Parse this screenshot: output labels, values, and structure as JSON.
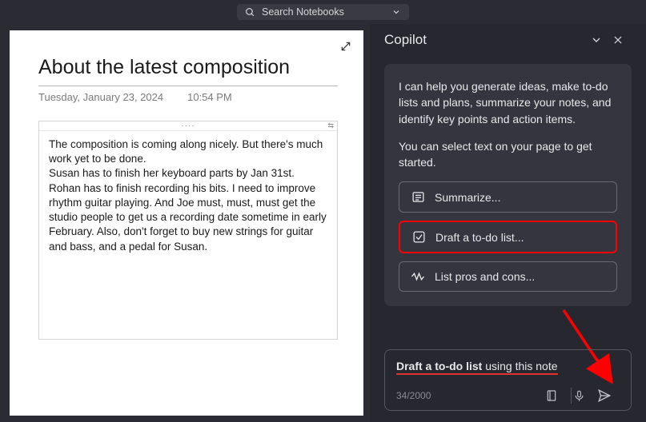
{
  "topbar": {
    "search_placeholder": "Search Notebooks"
  },
  "note": {
    "title": "About the latest composition",
    "date": "Tuesday, January 23, 2024",
    "time": "10:54 PM",
    "body": "The composition is coming along nicely. But there's much work yet to be done.\nSusan has to finish her keyboard parts by Jan 31st. Rohan has to finish recording his bits. I need to improve rhythm guitar playing. And Joe must, must, must get the studio people to get us a recording date sometime in early February. Also, don't forget to buy new strings for guitar and bass, and a pedal for Susan."
  },
  "copilot": {
    "title": "Copilot",
    "intro1": "I can help you generate ideas, make to-do lists and plans, summarize your notes, and identify key points and action items.",
    "intro2": "You can select text on your page to get started.",
    "actions": {
      "summarize": "Summarize...",
      "todo": "Draft a to-do list...",
      "pros": "List pros and cons..."
    },
    "input": {
      "bold": "Draft a to-do list",
      "rest": " using this note",
      "counter": "34/2000"
    }
  }
}
